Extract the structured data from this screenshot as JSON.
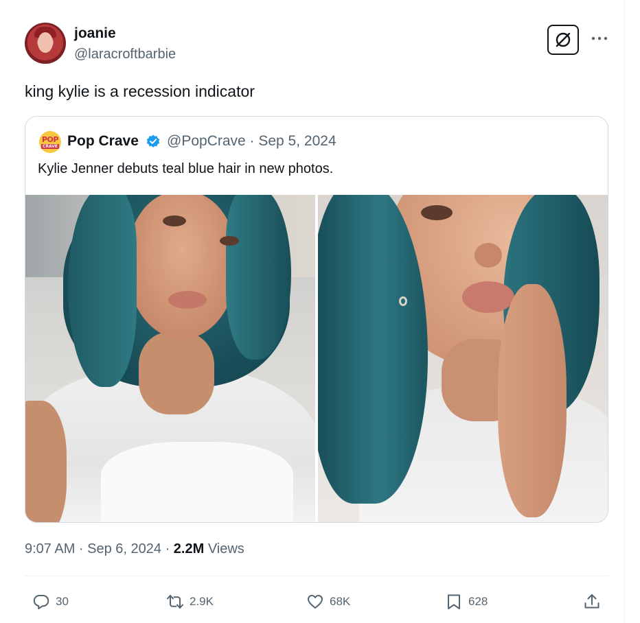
{
  "tweet": {
    "author": {
      "display_name": "joanie",
      "handle": "@laracroftbarbie"
    },
    "text": "king kylie is a recession indicator",
    "timestamp": "9:07 AM · Sep 6, 2024 · ",
    "views_count": "2.2M",
    "views_label": " Views"
  },
  "quote": {
    "avatar_text_top": "POP",
    "avatar_text_bottom": "CRAVE",
    "author_name": "Pop Crave",
    "meta": "@PopCrave · Sep 5, 2024",
    "text": "Kylie Jenner debuts teal blue hair in new photos."
  },
  "actions": {
    "replies": "30",
    "reposts": "2.9K",
    "likes": "68K",
    "bookmarks": "628"
  },
  "icons": {
    "grok": "grok-icon",
    "more": "more-icon",
    "verified": "verified-badge-icon",
    "reply": "reply-icon",
    "repost": "repost-icon",
    "like": "heart-icon",
    "bookmark": "bookmark-icon",
    "share": "share-icon"
  },
  "colors": {
    "text_primary": "#0f1419",
    "text_secondary": "#536471",
    "verified_blue": "#1d9bf0",
    "border": "#cfd9de"
  }
}
